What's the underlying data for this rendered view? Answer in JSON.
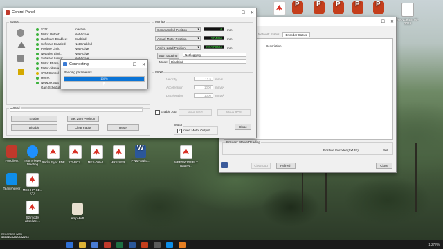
{
  "desktop_icons": [
    {
      "label": "FoxClient",
      "kind": "app"
    },
    {
      "label": "TeamViewer Meeting",
      "kind": "team"
    },
    {
      "label": "Radio Flyer PDF",
      "kind": "pdf"
    },
    {
      "label": "XTI-BC2...",
      "kind": "pdf"
    },
    {
      "label": "MES-090-1...",
      "kind": "pdf"
    },
    {
      "label": "MRS-SER...",
      "kind": "pdf"
    },
    {
      "label": "PWM-Switc...",
      "kind": "word"
    },
    {
      "label": "MFE090103 BLT Battery...",
      "kind": "pdf"
    },
    {
      "label": "TeamViewer",
      "kind": "tv"
    },
    {
      "label": "MES-HP-SE... (1)",
      "kind": "pdf"
    },
    {
      "label": "S2 model absolute ...",
      "kind": "pdf"
    },
    {
      "label": "AmpMVP",
      "kind": "amp"
    }
  ],
  "top_icons": [
    {
      "label": "",
      "kind": "pdf"
    },
    {
      "label": "",
      "kind": "ppt"
    },
    {
      "label": "",
      "kind": "ppt"
    },
    {
      "label": "",
      "kind": "ppt"
    },
    {
      "label": "",
      "kind": "ppt"
    },
    {
      "label": "",
      "kind": "ppt"
    }
  ],
  "control_panel": {
    "title": "Control Panel",
    "status_group": "Status",
    "status_rows": [
      {
        "label": "STO:",
        "value": "Inactive",
        "dot": "g"
      },
      {
        "label": "Motor Output:",
        "value": "Not Active",
        "dot": "g"
      },
      {
        "label": "Hardware Enabled:",
        "value": "Enabled",
        "dot": "g"
      },
      {
        "label": "Software Enabled:",
        "value": "Not Enabled",
        "dot": "g"
      },
      {
        "label": "Positive Limit:",
        "value": "Not Active",
        "dot": "g"
      },
      {
        "label": "Negative Limit:",
        "value": "Not Active",
        "dot": "g"
      },
      {
        "label": "Software Limits:",
        "value": "Not Active",
        "dot": "g"
      },
      {
        "label": "Motor Phase",
        "value": "",
        "dot": "g"
      },
      {
        "label": "Motor Absolu",
        "value": "",
        "dot": "g"
      },
      {
        "label": "CVM Control",
        "value": "",
        "dot": "y"
      },
      {
        "label": "Home:",
        "value": "",
        "dot": "g"
      },
      {
        "label": "Network Stat",
        "value": "",
        "dot": "g"
      },
      {
        "label": "Gain Scheduling:",
        "value": "Not Active",
        "dot": ""
      }
    ],
    "monitor_group": "Monitor",
    "monitor_rows": [
      {
        "combo": "Commanded Position",
        "value": "0",
        "unit": "mm"
      },
      {
        "combo": "Actual Motor Position",
        "value": "17.4456",
        "unit": "mm"
      },
      {
        "combo": "Active Load Position",
        "value": "21517.8516",
        "unit": "mm"
      }
    ],
    "start_logging": "Start Logging",
    "not_logging": "Not logging",
    "mode_label": "Mode:",
    "mode_value": "Disabled",
    "move_group": "Move",
    "move_rows": [
      {
        "label": "Velocity",
        "value": "12.5",
        "unit": "mm/s"
      },
      {
        "label": "Acceleration",
        "value": "1000",
        "unit": "mm/s²"
      },
      {
        "label": "Deceleration",
        "value": "1000",
        "unit": "mm/s²"
      }
    ],
    "enable_jog": "Enable Jog",
    "move_neg": "Move NEG",
    "move_pos": "Move POS",
    "motor_group": "Motor",
    "invert_motor": "Invert Motor Output",
    "control_group": "Control",
    "enable": "Enable",
    "disable": "Disable",
    "set_zero": "Set Zero Position",
    "clear_faults": "Clear Faults",
    "reset": "Reset",
    "close": "Close"
  },
  "connecting": {
    "title": "Connecting",
    "message": "Reading parameters",
    "percent_text": "100%",
    "progress": 1.0
  },
  "encoder_window": {
    "tabs": [
      "Network Status",
      "Encoder Status"
    ],
    "active_tab": 1,
    "description_header": "Description",
    "reading_label": "Encoder Status Reading",
    "position_label": "Position Encoder (0x13F)",
    "position_value": "Bell",
    "clear_log": "Clear Log",
    "refresh": "Refresh",
    "close": "Close"
  },
  "top_right_icon": {
    "label": "Recycle Bin 00-2019"
  },
  "taskbar": {
    "recorded": "RECORDED WITH",
    "brand": "SCREENCAST-O-MATIC",
    "time": "1:27 PM",
    "date": "8/21/2019"
  }
}
